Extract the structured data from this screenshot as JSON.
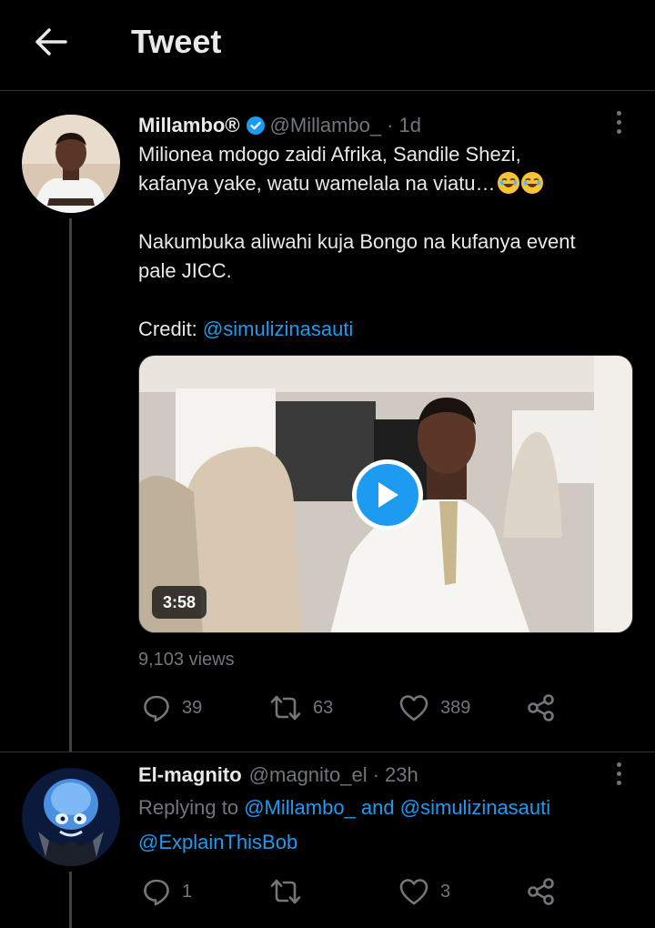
{
  "header": {
    "title": "Tweet",
    "back_icon": "arrow-left-icon"
  },
  "tweet": {
    "author_name": "Millambo®",
    "verified": true,
    "handle": "@Millambo_",
    "time": "1d",
    "text_line1": "Milionea mdogo zaidi Afrika, Sandile Shezi,",
    "text_line2": "kafanya yake, watu wamelala na viatu…",
    "text_para2_line1": "Nakumbuka aliwahi kuja Bongo na kufanya event",
    "text_para2_line2": "pale JICC.",
    "credit_label": "Credit:",
    "credit_link": "@simulizinasauti",
    "video_duration": "3:58",
    "views": "9,103 views",
    "actions": {
      "replies": "39",
      "retweets": "63",
      "likes": "389"
    }
  },
  "reply": {
    "author_name": "El-magnito",
    "handle": "@magnito_el",
    "time": "23h",
    "replying_to_label": "Replying to",
    "replying_to_1": "@Millambo_",
    "and_label": "and",
    "replying_to_2": "@simulizinasauti",
    "text": "@ExplainThisBob",
    "actions": {
      "replies": "1",
      "retweets": "",
      "likes": "3"
    }
  },
  "colors": {
    "background": "#000000",
    "text": "#e7e9ea",
    "muted": "#71767b",
    "accent": "#1d9bf0",
    "divider": "#2f3336"
  }
}
